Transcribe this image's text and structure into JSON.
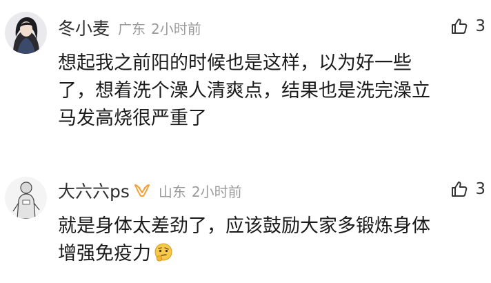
{
  "comments": [
    {
      "username": "冬小麦",
      "location": "广东",
      "time": "2小时前",
      "likes": "3",
      "avatar_icon": "avatar-girl-dark-hair",
      "content_lines": [
        "想起我之前阳的时候也是这样，以为好一些",
        "了，想着洗个澡人清爽点，结果也是洗完澡立",
        "马发高烧很严重了"
      ]
    },
    {
      "username": "大六六ps",
      "location": "山东",
      "time": "2小时前",
      "likes": "3",
      "avatar_icon": "avatar-sketch-figure",
      "badge_icon": "vip-badge-icon",
      "content_lines": [
        "就是身体太差劲了，应该鼓励大家多锻炼身体",
        "增强免疫力"
      ],
      "trailing_emoji": "thinking-face-emoji"
    }
  ],
  "colors": {
    "name": "#2f2f2f",
    "meta": "#9a9a9a",
    "content": "#1a1a1a",
    "badge": "#f2a23a"
  }
}
